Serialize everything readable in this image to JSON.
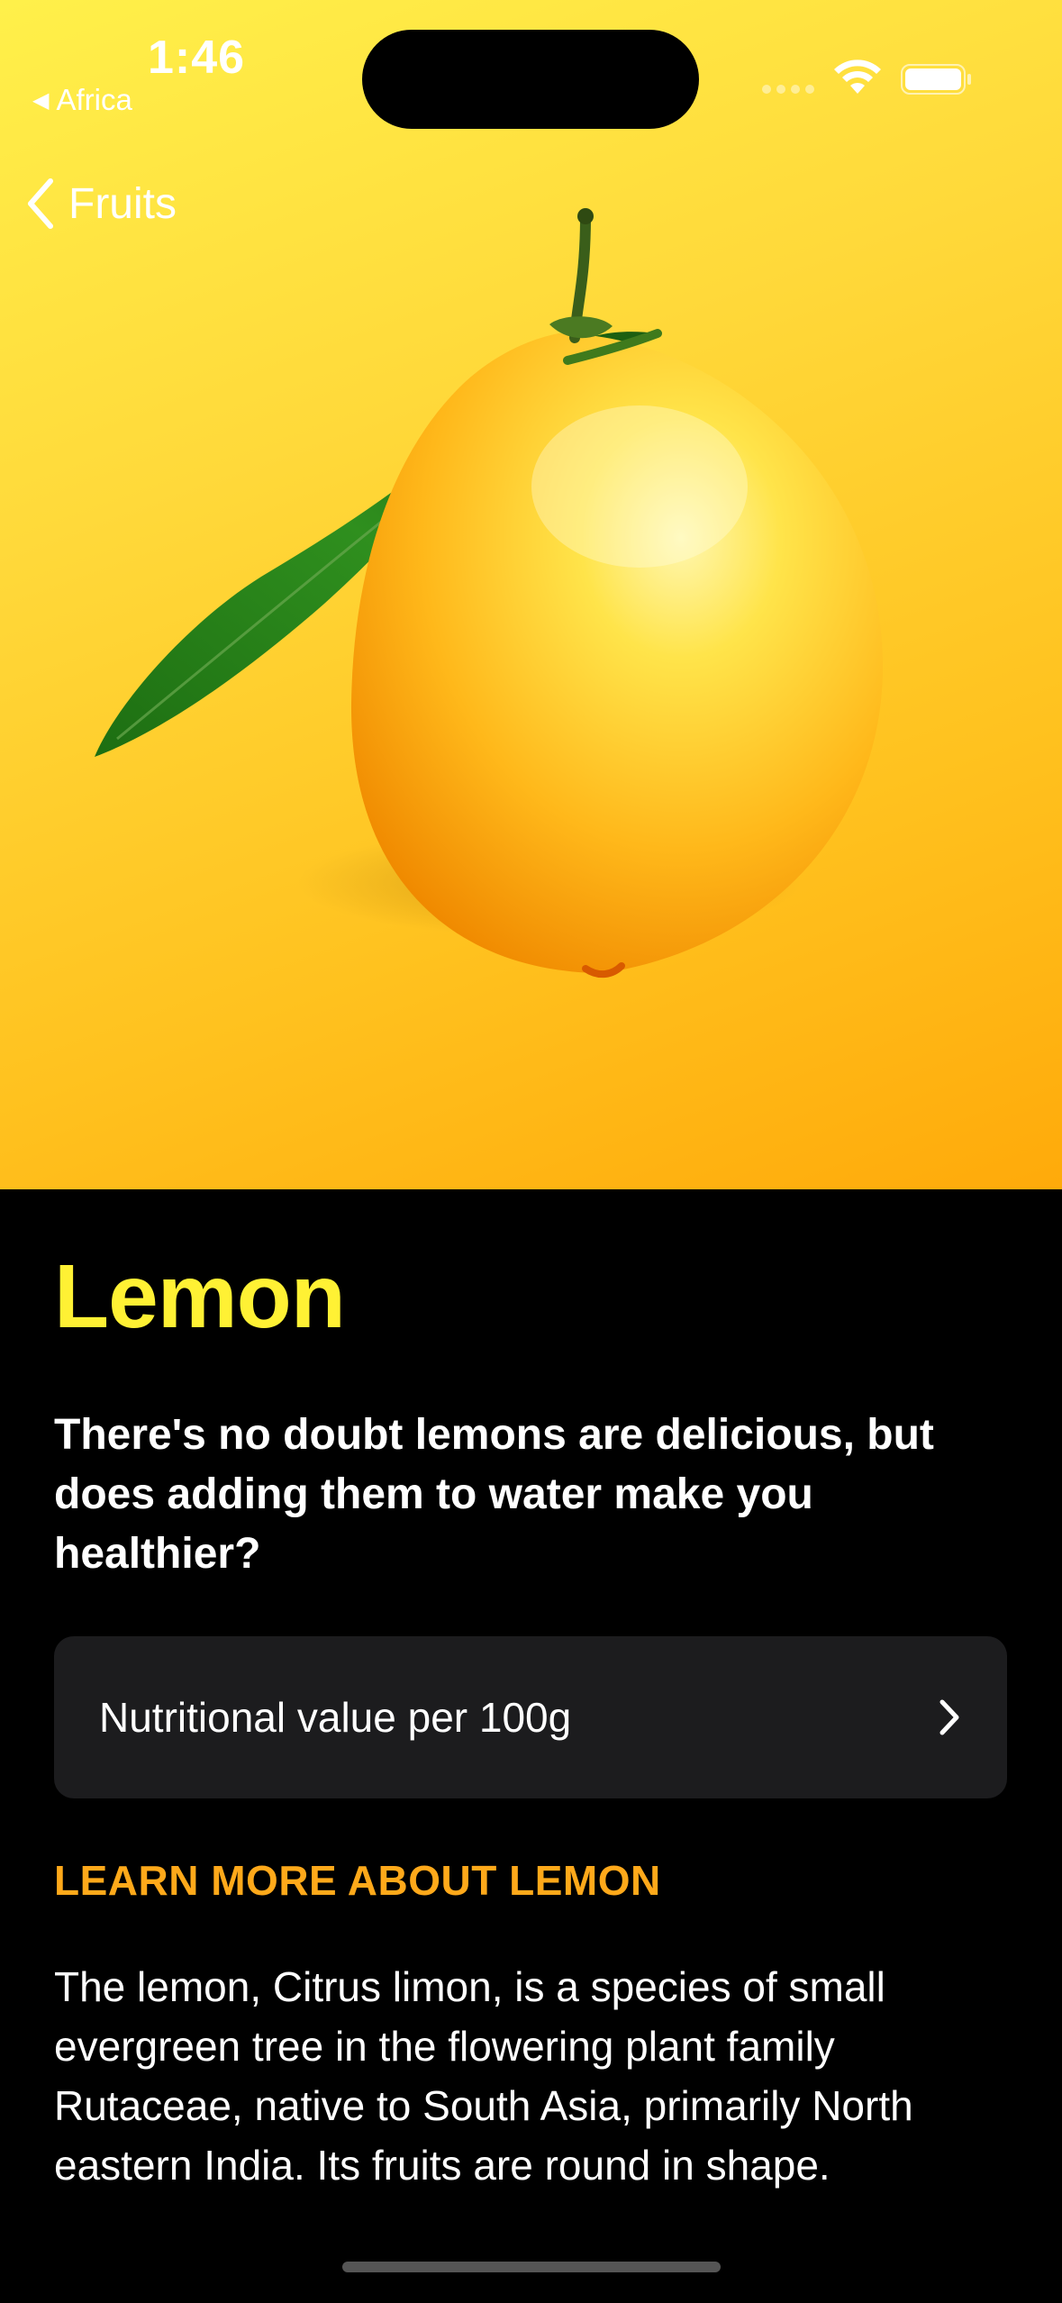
{
  "status_bar": {
    "time": "1:46",
    "back_app": "Africa",
    "back_app_glyph": "◀"
  },
  "nav": {
    "back_label": "Fruits"
  },
  "fruit": {
    "title": "Lemon",
    "headline": "There's no doubt lemons are delicious, but does adding them to water make you healthier?",
    "nutrition_label": "Nutritional value per 100g",
    "section_header": "LEARN MORE ABOUT LEMON",
    "description": "The lemon, Citrus limon, is a species of small evergreen tree in the flowering plant family Rutaceae, native to South Asia, primarily North eastern India. Its fruits are round in shape."
  },
  "colors": {
    "accent_title": "#fff134",
    "accent_section": "#ffa91a",
    "hero_gradient_start": "#fff04a",
    "hero_gradient_end": "#ffaa0a",
    "row_background": "#1c1c1e"
  },
  "icons": {
    "nav_back": "chevron-left-icon",
    "row_disclosure": "chevron-right-icon",
    "wifi": "wifi-icon",
    "battery": "battery-icon"
  }
}
